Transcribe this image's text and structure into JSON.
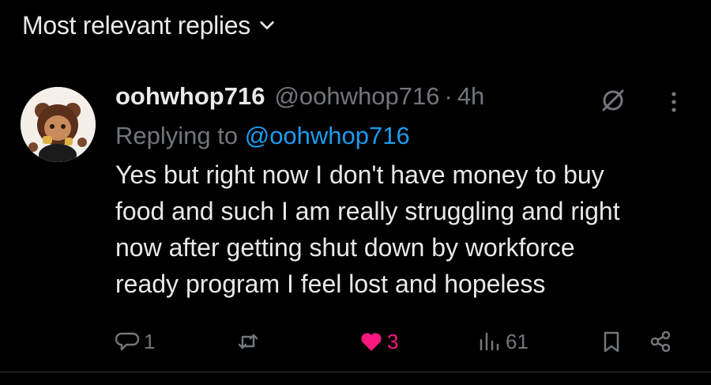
{
  "sort": {
    "label": "Most relevant replies"
  },
  "reply": {
    "name": "oohwhop716",
    "handle": "@oohwhop716",
    "separator": "·",
    "time": "4h",
    "replying_prefix": "Replying to",
    "replying_to": "@oohwhop716",
    "lines": [
      "Yes but right now I don't have money to buy",
      "food and such I am really struggling and right",
      "now after getting shut down by workforce",
      "ready program I feel lost and hopeless"
    ]
  },
  "actions": {
    "replies": "1",
    "reposts": "",
    "likes": "3",
    "views": "61"
  },
  "colors": {
    "background": "#000000",
    "text": "#e7e9ea",
    "muted": "#71767b",
    "link": "#1d9bf0",
    "like": "#f91880"
  },
  "icons": [
    "chevron-down-icon",
    "grok-icon",
    "more-icon",
    "reply-icon",
    "repost-icon",
    "heart-icon",
    "views-icon",
    "bookmark-icon",
    "share-icon"
  ]
}
